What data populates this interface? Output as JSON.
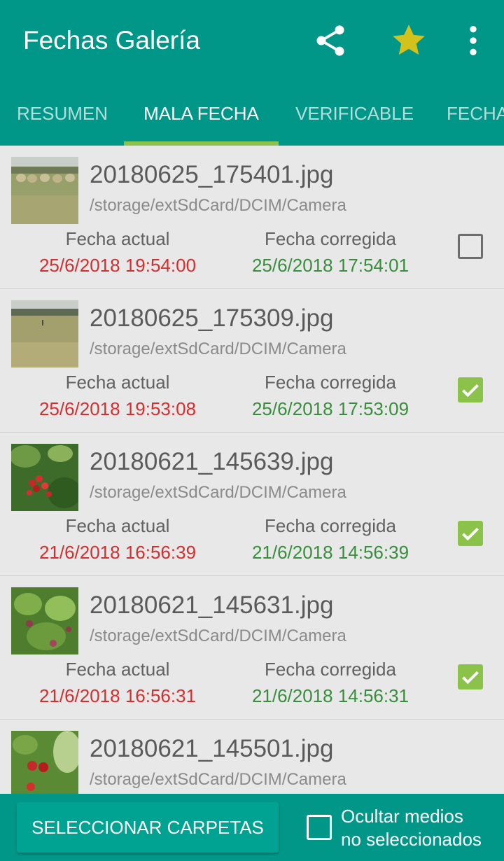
{
  "appbar": {
    "title": "Fechas Galería",
    "icons": [
      "share-icon",
      "star-icon",
      "more-vert-icon"
    ]
  },
  "tabs": [
    {
      "label": "RESUMEN"
    },
    {
      "label": "MALA FECHA"
    },
    {
      "label": "VERIFICABLE"
    },
    {
      "label": "FECHA"
    }
  ],
  "active_tab": "MALA FECHA",
  "list": {
    "label_actual": "Fecha actual",
    "label_corregida": "Fecha corregida",
    "items": [
      {
        "name": "20180625_175401.jpg",
        "path": "/storage/extSdCard/DCIM/Camera",
        "actual": "25/6/2018 19:54:00",
        "corregida": "25/6/2018 17:54:01",
        "checked": false
      },
      {
        "name": "20180625_175309.jpg",
        "path": "/storage/extSdCard/DCIM/Camera",
        "actual": "25/6/2018 19:53:08",
        "corregida": "25/6/2018 17:53:09",
        "checked": true
      },
      {
        "name": "20180621_145639.jpg",
        "path": "/storage/extSdCard/DCIM/Camera",
        "actual": "21/6/2018 16:56:39",
        "corregida": "21/6/2018 14:56:39",
        "checked": true
      },
      {
        "name": "20180621_145631.jpg",
        "path": "/storage/extSdCard/DCIM/Camera",
        "actual": "21/6/2018 16:56:31",
        "corregida": "21/6/2018 14:56:31",
        "checked": true
      },
      {
        "name": "20180621_145501.jpg",
        "path": "/storage/extSdCard/DCIM/Camera",
        "actual": "",
        "corregida": "",
        "checked": false
      }
    ]
  },
  "bottom": {
    "select_button": "SELECCIONAR CARPETAS",
    "hide_line1": "Ocultar medios",
    "hide_line2": "no seleccionados",
    "hide_checked": false
  },
  "colors": {
    "primary": "#009688",
    "accent": "#8bc34a",
    "date_wrong": "#d32f2f",
    "date_fixed": "#388e3c"
  }
}
